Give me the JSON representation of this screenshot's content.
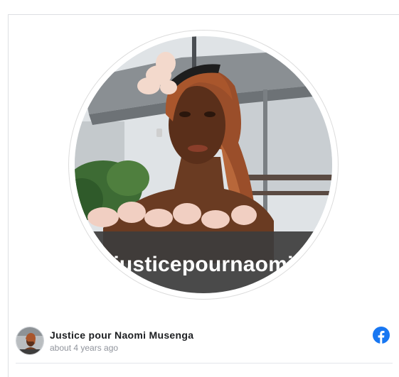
{
  "post": {
    "image_overlay_text": "justicepournaomi",
    "page_name": "Justice pour Naomi Musenga",
    "timestamp": "about 4 years ago"
  },
  "icons": {
    "platform": "facebook-icon"
  },
  "colors": {
    "facebook_blue": "#1877f2",
    "name_text": "#1c1e21",
    "meta_text": "#90949c"
  }
}
